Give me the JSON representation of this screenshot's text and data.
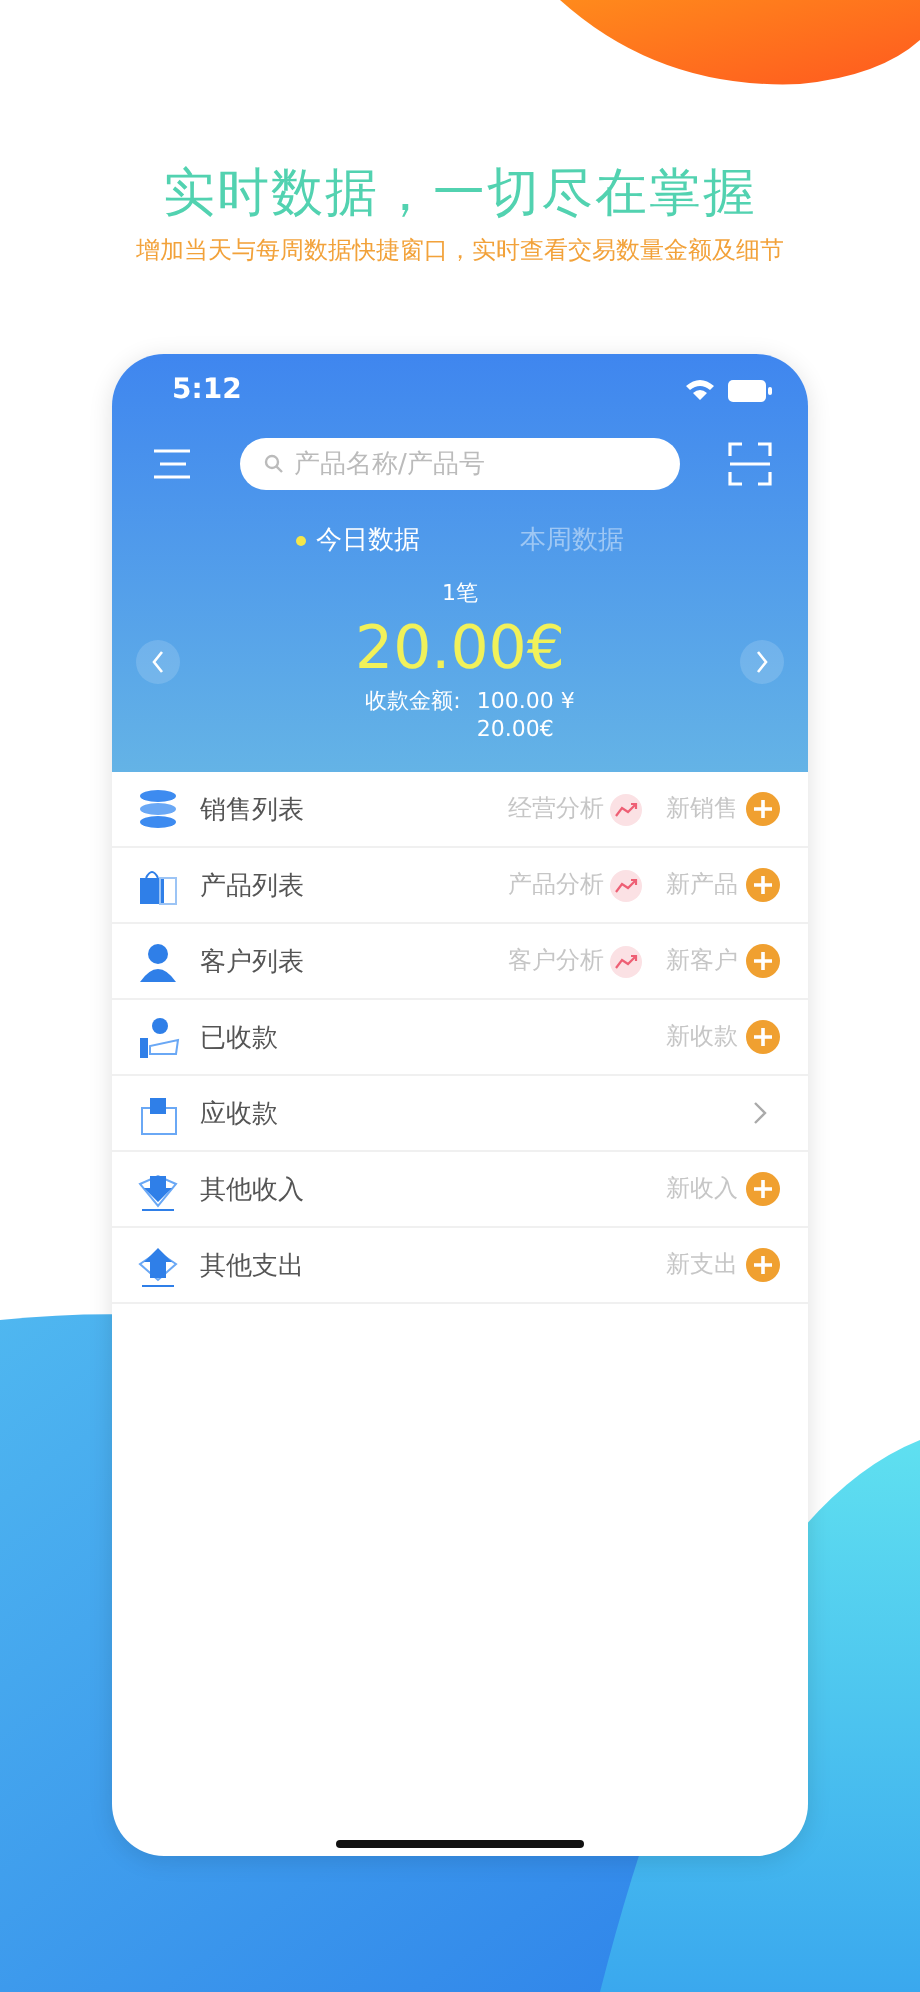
{
  "headline": "实时数据，一切尽在掌握",
  "subheadline": "增加当天与每周数据快捷窗口，实时查看交易数量金额及细节",
  "status_bar": {
    "time": "5:12"
  },
  "search": {
    "placeholder": "产品名称/产品号"
  },
  "tabs": [
    {
      "label": "今日数据",
      "selected": true
    },
    {
      "label": "本周数据",
      "selected": false
    }
  ],
  "summary": {
    "count": "1笔",
    "amount": "20.00€",
    "received_label": "收款金额:",
    "received_values": [
      "100.00 ¥",
      "20.00€"
    ]
  },
  "rows": [
    {
      "kind": "add",
      "label": "销售列表",
      "analysis": "经营分析",
      "action": "新销售"
    },
    {
      "kind": "add",
      "label": "产品列表",
      "analysis": "产品分析",
      "action": "新产品"
    },
    {
      "kind": "add",
      "label": "客户列表",
      "analysis": "客户分析",
      "action": "新客户"
    },
    {
      "kind": "add",
      "label": "已收款",
      "action": "新收款"
    },
    {
      "kind": "arrow",
      "label": "应收款"
    },
    {
      "kind": "add",
      "label": "其他收入",
      "action": "新收入"
    },
    {
      "kind": "add",
      "label": "其他支出",
      "action": "新支出"
    }
  ]
}
